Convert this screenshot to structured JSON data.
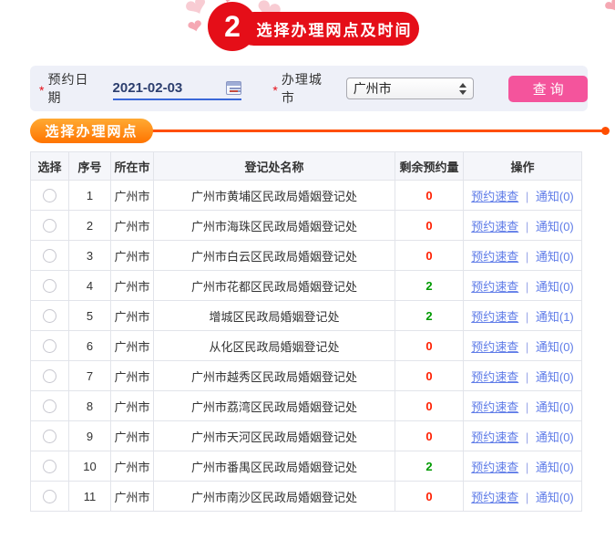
{
  "step_banner": {
    "number": "2",
    "title": "选择办理网点及时间",
    "heart_glyph": "❤"
  },
  "filter_bar": {
    "required_marker": "*",
    "date_label": "预约日期",
    "date_value": "2021-02-03",
    "city_label": "办理城市",
    "city_value": "广州市",
    "query_button": "查询"
  },
  "section": {
    "title": "选择办理网点"
  },
  "table": {
    "headers": [
      "选择",
      "序号",
      "所在市",
      "登记处名称",
      "剩余预约量",
      "操作"
    ],
    "links": {
      "quick_check": "预约速查",
      "separator": "|"
    },
    "rows": [
      {
        "no": "1",
        "city": "广州市",
        "name": "广州市黄埔区民政局婚姻登记处",
        "remaining": "0",
        "remaining_color": "red",
        "notice": "通知(0)"
      },
      {
        "no": "2",
        "city": "广州市",
        "name": "广州市海珠区民政局婚姻登记处",
        "remaining": "0",
        "remaining_color": "red",
        "notice": "通知(0)"
      },
      {
        "no": "3",
        "city": "广州市",
        "name": "广州市白云区民政局婚姻登记处",
        "remaining": "0",
        "remaining_color": "red",
        "notice": "通知(0)"
      },
      {
        "no": "4",
        "city": "广州市",
        "name": "广州市花都区民政局婚姻登记处",
        "remaining": "2",
        "remaining_color": "green",
        "notice": "通知(0)"
      },
      {
        "no": "5",
        "city": "广州市",
        "name": "增城区民政局婚姻登记处",
        "remaining": "2",
        "remaining_color": "green",
        "notice": "通知(1)"
      },
      {
        "no": "6",
        "city": "广州市",
        "name": "从化区民政局婚姻登记处",
        "remaining": "0",
        "remaining_color": "red",
        "notice": "通知(0)"
      },
      {
        "no": "7",
        "city": "广州市",
        "name": "广州市越秀区民政局婚姻登记处",
        "remaining": "0",
        "remaining_color": "red",
        "notice": "通知(0)"
      },
      {
        "no": "8",
        "city": "广州市",
        "name": "广州市荔湾区民政局婚姻登记处",
        "remaining": "0",
        "remaining_color": "red",
        "notice": "通知(0)"
      },
      {
        "no": "9",
        "city": "广州市",
        "name": "广州市天河区民政局婚姻登记处",
        "remaining": "0",
        "remaining_color": "red",
        "notice": "通知(0)"
      },
      {
        "no": "10",
        "city": "广州市",
        "name": "广州市番禺区民政局婚姻登记处",
        "remaining": "2",
        "remaining_color": "green",
        "notice": "通知(0)"
      },
      {
        "no": "11",
        "city": "广州市",
        "name": "广州市南沙区民政局婚姻登记处",
        "remaining": "0",
        "remaining_color": "red",
        "notice": "通知(0)"
      }
    ]
  },
  "colors": {
    "banner_red": "#e50e18",
    "button_pink": "#f4549c",
    "section_orange": "#ff7400",
    "divider_orange": "#ff4e00",
    "link_blue": "#5f7ce8",
    "count_red": "#ff1e00",
    "count_green": "#009a00",
    "filter_bg": "#eef0f8"
  }
}
